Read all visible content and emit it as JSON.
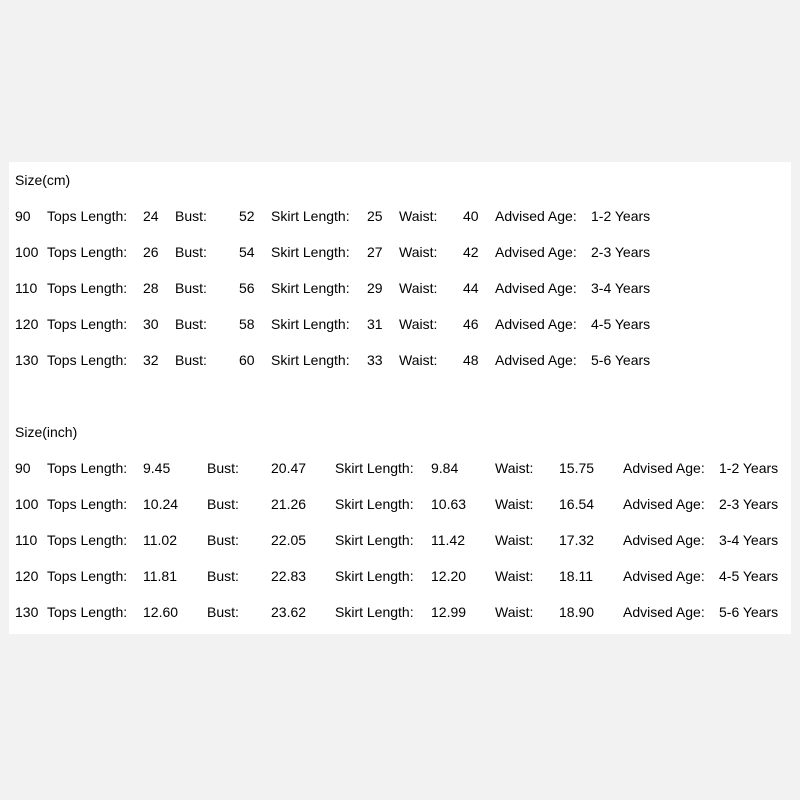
{
  "cm": {
    "heading": "Size(cm)",
    "rows": [
      {
        "size": "90",
        "tops_label": "Tops Length:",
        "tops": "24",
        "bust_label": "Bust:",
        "bust": "52",
        "skirt_label": "Skirt Length:",
        "skirt": "25",
        "waist_label": "Waist:",
        "waist": "40",
        "age_label": "Advised Age:",
        "age": "1-2 Years"
      },
      {
        "size": "100",
        "tops_label": "Tops Length:",
        "tops": "26",
        "bust_label": "Bust:",
        "bust": "54",
        "skirt_label": "Skirt Length:",
        "skirt": "27",
        "waist_label": "Waist:",
        "waist": "42",
        "age_label": "Advised Age:",
        "age": "2-3 Years"
      },
      {
        "size": "110",
        "tops_label": "Tops Length:",
        "tops": "28",
        "bust_label": "Bust:",
        "bust": "56",
        "skirt_label": "Skirt Length:",
        "skirt": "29",
        "waist_label": "Waist:",
        "waist": "44",
        "age_label": "Advised Age:",
        "age": "3-4 Years"
      },
      {
        "size": "120",
        "tops_label": "Tops Length:",
        "tops": "30",
        "bust_label": "Bust:",
        "bust": "58",
        "skirt_label": "Skirt Length:",
        "skirt": "31",
        "waist_label": "Waist:",
        "waist": "46",
        "age_label": "Advised Age:",
        "age": "4-5 Years"
      },
      {
        "size": "130",
        "tops_label": "Tops Length:",
        "tops": "32",
        "bust_label": "Bust:",
        "bust": "60",
        "skirt_label": "Skirt Length:",
        "skirt": "33",
        "waist_label": "Waist:",
        "waist": "48",
        "age_label": "Advised Age:",
        "age": "5-6 Years"
      }
    ]
  },
  "inch": {
    "heading": "Size(inch)",
    "rows": [
      {
        "size": "90",
        "tops_label": "Tops Length:",
        "tops": "9.45",
        "bust_label": "Bust:",
        "bust": "20.47",
        "skirt_label": "Skirt Length:",
        "skirt": "9.84",
        "waist_label": "Waist:",
        "waist": "15.75",
        "age_label": "Advised Age:",
        "age": "1-2 Years"
      },
      {
        "size": "100",
        "tops_label": "Tops Length:",
        "tops": "10.24",
        "bust_label": "Bust:",
        "bust": "21.26",
        "skirt_label": "Skirt Length:",
        "skirt": "10.63",
        "waist_label": "Waist:",
        "waist": "16.54",
        "age_label": "Advised Age:",
        "age": "2-3 Years"
      },
      {
        "size": "110",
        "tops_label": "Tops Length:",
        "tops": "11.02",
        "bust_label": "Bust:",
        "bust": "22.05",
        "skirt_label": "Skirt Length:",
        "skirt": "11.42",
        "waist_label": "Waist:",
        "waist": "17.32",
        "age_label": "Advised Age:",
        "age": "3-4 Years"
      },
      {
        "size": "120",
        "tops_label": "Tops Length:",
        "tops": "11.81",
        "bust_label": "Bust:",
        "bust": "22.83",
        "skirt_label": "Skirt Length:",
        "skirt": "12.20",
        "waist_label": "Waist:",
        "waist": "18.11",
        "age_label": "Advised Age:",
        "age": "4-5 Years"
      },
      {
        "size": "130",
        "tops_label": "Tops Length:",
        "tops": "12.60",
        "bust_label": "Bust:",
        "bust": "23.62",
        "skirt_label": "Skirt Length:",
        "skirt": "12.99",
        "waist_label": "Waist:",
        "waist": "18.90",
        "age_label": "Advised Age:",
        "age": "5-6 Years"
      }
    ]
  }
}
